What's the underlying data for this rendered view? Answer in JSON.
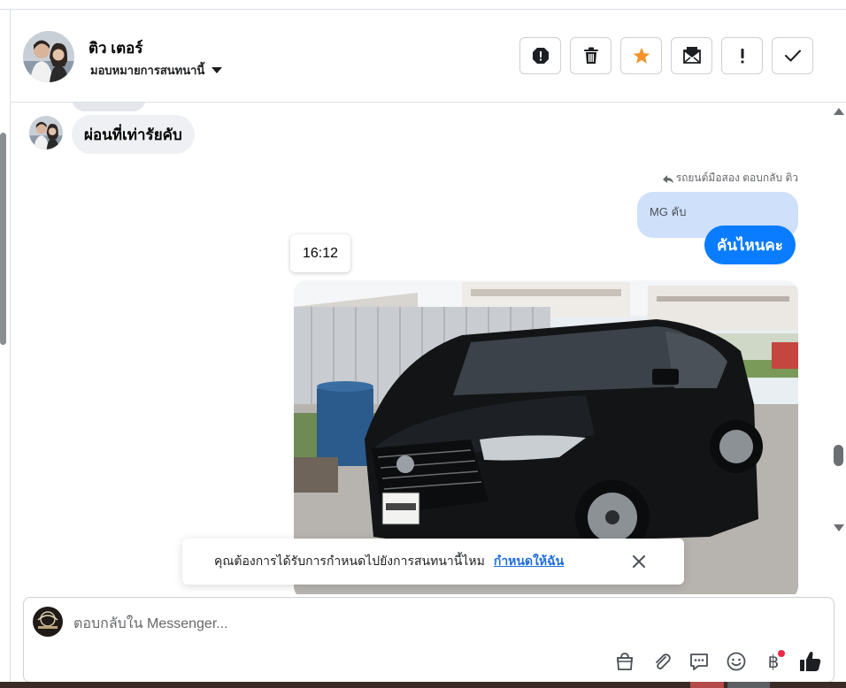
{
  "header": {
    "contact_name": "ติว เตอร์",
    "assign_label": "มอบหมายการสนทนานี้",
    "actions": [
      "spam-icon",
      "trash-icon",
      "star-icon",
      "unread-icon",
      "follow-up-icon",
      "done-icon"
    ]
  },
  "messages": {
    "incoming_text": "ผ่อนที่เท่ารัยคับ",
    "reply_note": "รถยนต์มือสอง ตอบกลับ ติว",
    "quoted_text": "MG คับ",
    "outgoing_text": "คันไหนคะ",
    "timestamp": "16:12"
  },
  "toast": {
    "text": "คุณต้องการได้รับการกำหนดไปยังการสนทนานี้ไหม",
    "link": "กำหนดให้ฉัน"
  },
  "composer": {
    "placeholder": "ตอบกลับใน Messenger...",
    "baht_symbol": "฿"
  },
  "colors": {
    "accent_blue": "#0a7cff",
    "quoted_bg": "#cfe0fb",
    "star": "#f5922a"
  }
}
